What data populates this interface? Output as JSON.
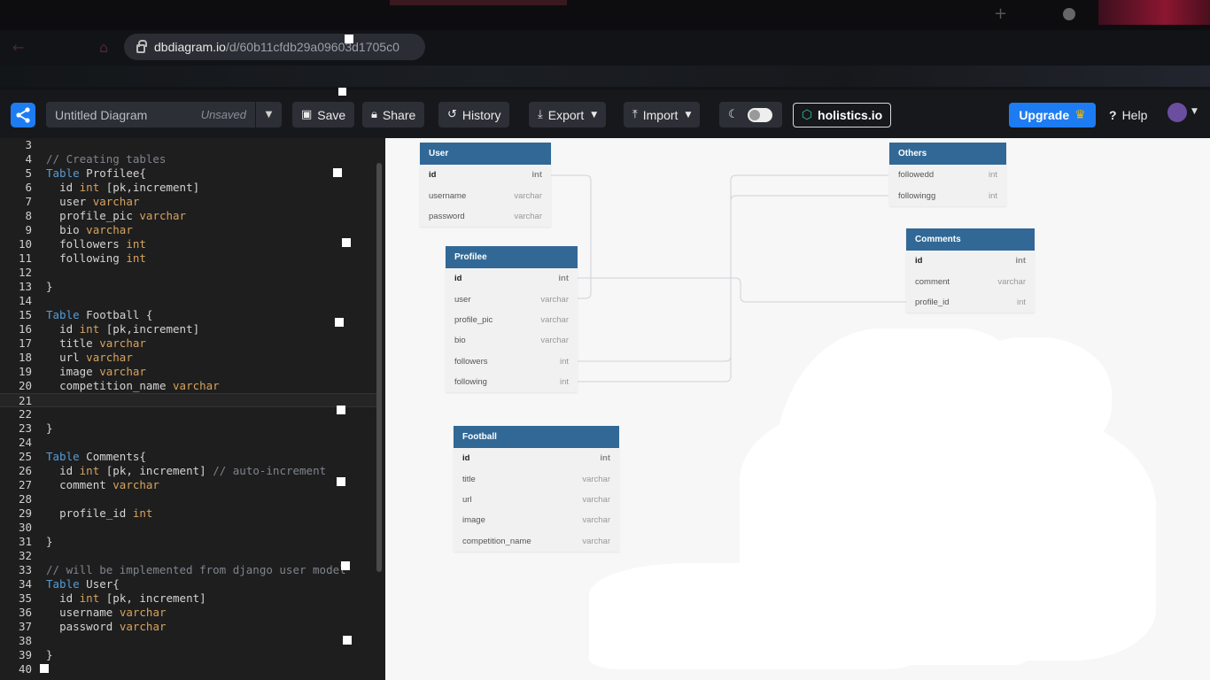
{
  "browser": {
    "url_domain": "dbdiagram.io",
    "url_path": "/d/60b11cfdb29a09603d1705c0"
  },
  "header": {
    "diagram_name": "Untitled Diagram",
    "diagram_status": "Unsaved",
    "save_label": "Save",
    "share_label": "Share",
    "history_label": "History",
    "export_label": "Export",
    "import_label": "Import",
    "holistics_label": "holistics.io",
    "upgrade_label": "Upgrade",
    "help_label": "Help"
  },
  "editor": {
    "lines": [
      {
        "n": "3",
        "code": ""
      },
      {
        "n": "4",
        "code": "// Creating tables"
      },
      {
        "n": "5",
        "code": "Table Profilee{"
      },
      {
        "n": "6",
        "code": "  id int [pk,increment]"
      },
      {
        "n": "7",
        "code": "  user varchar"
      },
      {
        "n": "8",
        "code": "  profile_pic varchar"
      },
      {
        "n": "9",
        "code": "  bio varchar"
      },
      {
        "n": "10",
        "code": "  followers int"
      },
      {
        "n": "11",
        "code": "  following int"
      },
      {
        "n": "12",
        "code": ""
      },
      {
        "n": "13",
        "code": "}"
      },
      {
        "n": "14",
        "code": ""
      },
      {
        "n": "15",
        "code": "Table Football {"
      },
      {
        "n": "16",
        "code": "  id int [pk,increment]"
      },
      {
        "n": "17",
        "code": "  title varchar"
      },
      {
        "n": "18",
        "code": "  url varchar"
      },
      {
        "n": "19",
        "code": "  image varchar"
      },
      {
        "n": "20",
        "code": "  competition_name varchar"
      },
      {
        "n": "21",
        "code": ""
      },
      {
        "n": "22",
        "code": ""
      },
      {
        "n": "23",
        "code": "}"
      },
      {
        "n": "24",
        "code": ""
      },
      {
        "n": "25",
        "code": "Table Comments{"
      },
      {
        "n": "26",
        "code": "  id int [pk, increment] // auto-increment"
      },
      {
        "n": "27",
        "code": "  comment varchar"
      },
      {
        "n": "28",
        "code": ""
      },
      {
        "n": "29",
        "code": "  profile_id int"
      },
      {
        "n": "30",
        "code": ""
      },
      {
        "n": "31",
        "code": "}"
      },
      {
        "n": "32",
        "code": ""
      },
      {
        "n": "33",
        "code": "// will be implemented from django user model"
      },
      {
        "n": "34",
        "code": "Table User{"
      },
      {
        "n": "35",
        "code": "  id int [pk, increment]"
      },
      {
        "n": "36",
        "code": "  username varchar"
      },
      {
        "n": "37",
        "code": "  password varchar"
      },
      {
        "n": "38",
        "code": ""
      },
      {
        "n": "39",
        "code": "}"
      },
      {
        "n": "40",
        "code": ""
      }
    ],
    "active_line": "21"
  },
  "diagram": {
    "tables": [
      {
        "id": "user",
        "name": "User",
        "fields": [
          {
            "name": "id",
            "type": "int",
            "pk": true
          },
          {
            "name": "username",
            "type": "varchar"
          },
          {
            "name": "password",
            "type": "varchar"
          }
        ]
      },
      {
        "id": "profilee",
        "name": "Profilee",
        "fields": [
          {
            "name": "id",
            "type": "int",
            "pk": true
          },
          {
            "name": "user",
            "type": "varchar"
          },
          {
            "name": "profile_pic",
            "type": "varchar"
          },
          {
            "name": "bio",
            "type": "varchar"
          },
          {
            "name": "followers",
            "type": "int"
          },
          {
            "name": "following",
            "type": "int"
          }
        ]
      },
      {
        "id": "others",
        "name": "Others",
        "fields": [
          {
            "name": "followedd",
            "type": "int"
          },
          {
            "name": "followingg",
            "type": "int"
          }
        ]
      },
      {
        "id": "comments",
        "name": "Comments",
        "fields": [
          {
            "name": "id",
            "type": "int",
            "pk": true
          },
          {
            "name": "comment",
            "type": "varchar"
          },
          {
            "name": "profile_id",
            "type": "int"
          }
        ]
      },
      {
        "id": "football",
        "name": "Football",
        "fields": [
          {
            "name": "id",
            "type": "int",
            "pk": true
          },
          {
            "name": "title",
            "type": "varchar"
          },
          {
            "name": "url",
            "type": "varchar"
          },
          {
            "name": "image",
            "type": "varchar"
          },
          {
            "name": "competition_name",
            "type": "varchar"
          }
        ]
      }
    ]
  },
  "colors": {
    "accent": "#1d7cf2",
    "table_header": "#316896",
    "keyword": "#569cd6",
    "type": "#d7a35f",
    "comment": "#7f848e"
  }
}
